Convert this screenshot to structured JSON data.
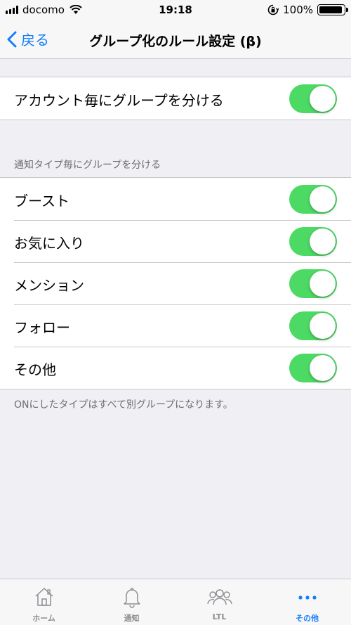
{
  "status_bar": {
    "carrier": "docomo",
    "time": "19:18",
    "battery": "100%"
  },
  "nav": {
    "back_label": "戻る",
    "title": "グループ化のルール設定 (β)"
  },
  "account_group": {
    "label": "アカウント毎にグループを分ける",
    "on": true
  },
  "type_section": {
    "header": "通知タイプ毎にグループを分ける",
    "items": [
      {
        "label": "ブースト",
        "on": true
      },
      {
        "label": "お気に入り",
        "on": true
      },
      {
        "label": "メンション",
        "on": true
      },
      {
        "label": "フォロー",
        "on": true
      },
      {
        "label": "その他",
        "on": true
      }
    ],
    "footer": "ONにしたタイプはすべて別グループになります。"
  },
  "tabbar": {
    "tabs": [
      {
        "label": "ホーム",
        "icon": "home-icon"
      },
      {
        "label": "通知",
        "icon": "bell-icon"
      },
      {
        "label": "LTL",
        "icon": "people-icon"
      },
      {
        "label": "その他",
        "icon": "more-dots-icon"
      }
    ],
    "active_index": 3
  },
  "colors": {
    "accent": "#147efb",
    "switch_on": "#4cd964",
    "background": "#efeff4"
  }
}
